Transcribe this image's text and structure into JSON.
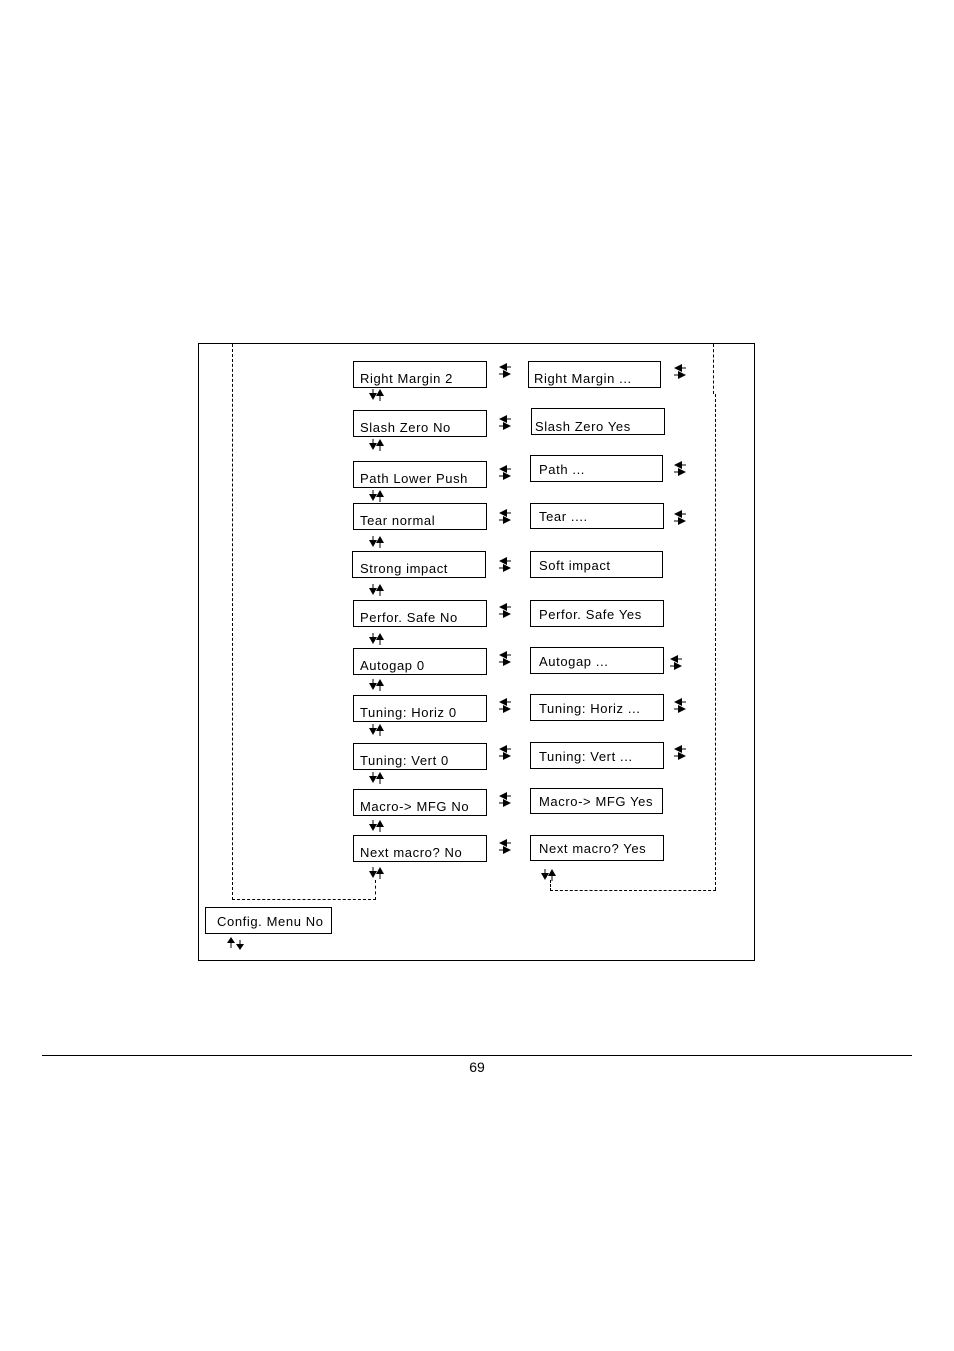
{
  "diagram": {
    "left_column": [
      {
        "label": "Right Margin 2"
      },
      {
        "label": "Slash Zero  No"
      },
      {
        "label": "Path Lower Push"
      },
      {
        "label": "Tear normal"
      },
      {
        "label": "Strong impact"
      },
      {
        "label": "Perfor. Safe No"
      },
      {
        "label": "Autogap 0"
      },
      {
        "label": "Tuning: Horiz  0"
      },
      {
        "label": "Tuning: Vert 0"
      },
      {
        "label": "Macro-> MFG No"
      },
      {
        "label": "Next macro? No"
      }
    ],
    "right_column": [
      {
        "label": "Right Margin ..."
      },
      {
        "label": "Slash Zero  Yes"
      },
      {
        "label": "Path ..."
      },
      {
        "label": "Tear ...."
      },
      {
        "label": "Soft impact"
      },
      {
        "label": "Perfor. Safe Yes"
      },
      {
        "label": "Autogap ..."
      },
      {
        "label": "Tuning: Horiz  ..."
      },
      {
        "label": "Tuning: Vert ..."
      },
      {
        "label": "Macro-> MFG Yes"
      },
      {
        "label": "Next macro? Yes"
      }
    ],
    "config_box": {
      "label": "Config. Menu No"
    },
    "icons": {
      "vertical_nav": "down-up-arrows-icon",
      "horizontal_toggle": "left-right-toggle-arrows-icon",
      "config_nav": "up-down-arrows-icon"
    }
  },
  "footer": {
    "page_number": "69"
  }
}
